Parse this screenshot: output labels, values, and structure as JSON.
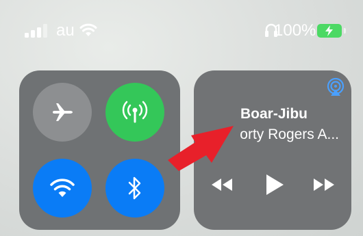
{
  "status_bar": {
    "carrier": "au",
    "battery_percent": "100%",
    "battery_charging": true,
    "icons": [
      "signal-icon",
      "wifi-icon",
      "headphones-icon",
      "battery-icon"
    ]
  },
  "connectivity": {
    "airplane_mode": {
      "icon": "airplane-icon",
      "on": false
    },
    "cellular_data": {
      "icon": "antenna-icon",
      "on": true
    },
    "wifi": {
      "icon": "wifi-icon",
      "on": true
    },
    "bluetooth": {
      "icon": "bluetooth-icon",
      "on": true
    }
  },
  "media": {
    "title": "Boar-Jibu",
    "artist": "orty Rogers A...",
    "controls": [
      "rewind-icon",
      "play-icon",
      "fast-forward-icon"
    ],
    "airplay_icon": "airplay-icon"
  },
  "annotation": {
    "icon": "red-arrow",
    "color": "#e8202a"
  },
  "colors": {
    "green": "#34c759",
    "blue": "#0a7cf6",
    "panel": "#6f7274"
  }
}
